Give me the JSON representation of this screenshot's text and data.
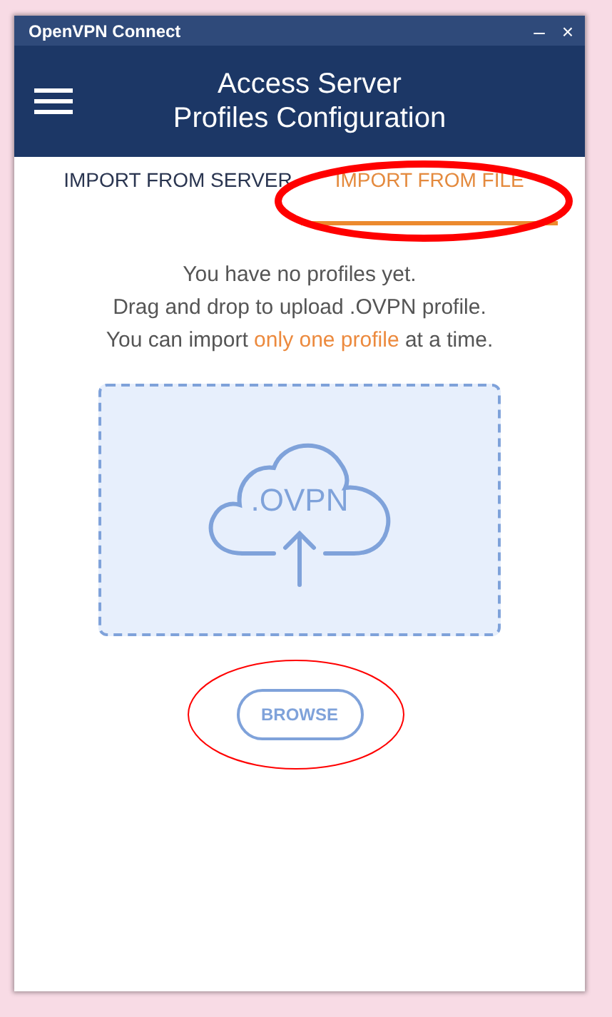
{
  "window": {
    "title": "OpenVPN Connect",
    "controls": [
      "–",
      "×"
    ]
  },
  "header": {
    "title_lines": [
      "Access Server",
      "Profiles Configuration"
    ]
  },
  "tabs": [
    {
      "label": "IMPORT FROM SERVER",
      "selected": false
    },
    {
      "label": "IMPORT FROM FILE",
      "selected": true
    }
  ],
  "message": {
    "lines": [
      [
        {
          "text": "You have no profiles yet.",
          "accent": false
        }
      ],
      [
        {
          "text": "Drag and drop to upload .OVPN profile.",
          "accent": false
        }
      ],
      [
        {
          "text": "You can import ",
          "accent": false
        },
        {
          "text": "only one profile",
          "accent": true
        },
        {
          "text": " at a time.",
          "accent": false
        }
      ]
    ]
  },
  "drop_zone": {
    "label": ".OVPN"
  },
  "browse_button": {
    "label": "BROWSE"
  },
  "annotations": [
    {
      "kind": "thick"
    },
    {
      "kind": "thin"
    }
  ]
}
